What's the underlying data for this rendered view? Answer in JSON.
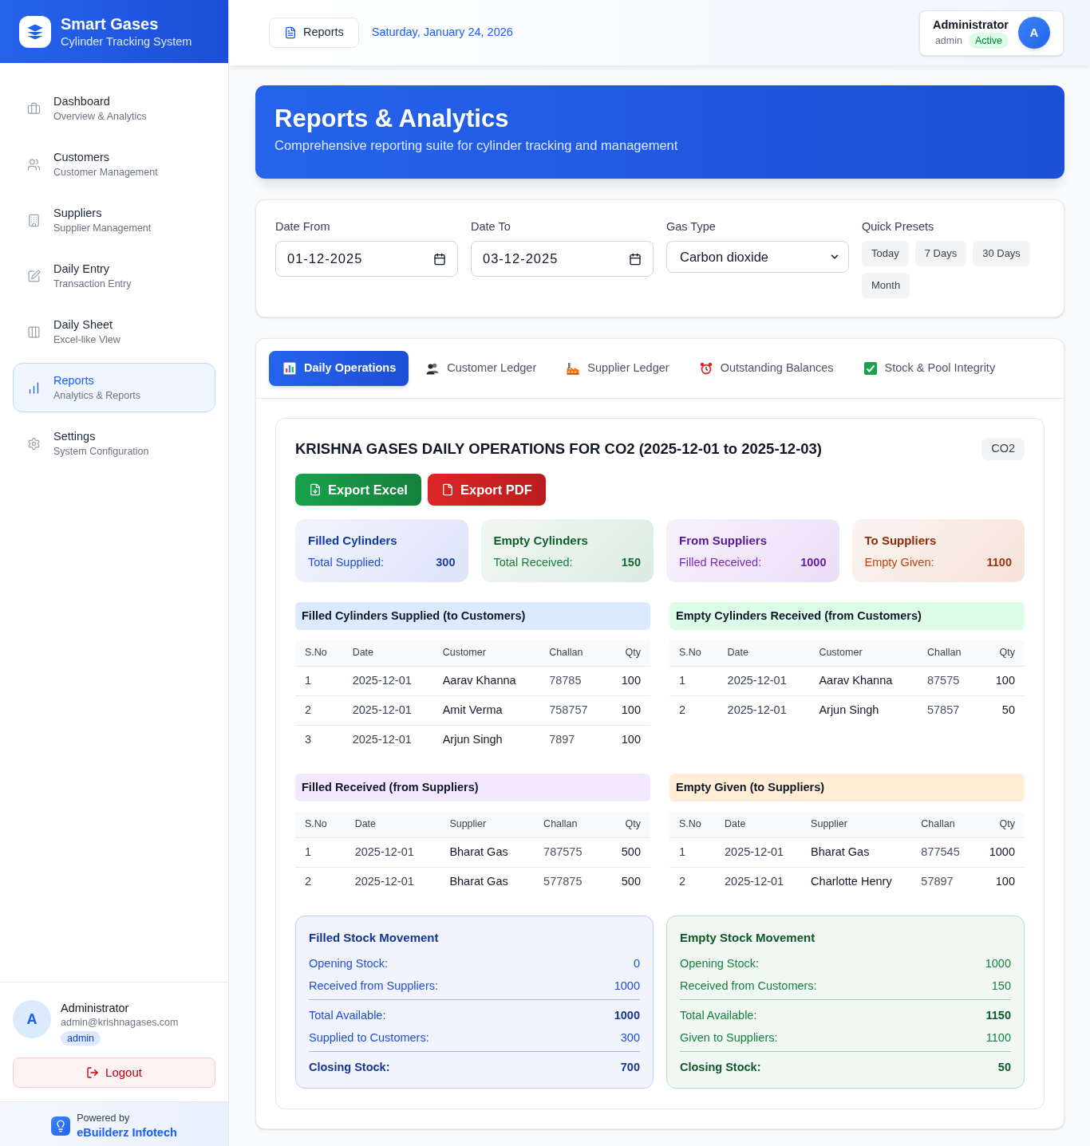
{
  "sidebar": {
    "brand": {
      "title": "Smart Gases",
      "subtitle": "Cylinder Tracking System"
    },
    "items": [
      {
        "label": "Dashboard",
        "sublabel": "Overview & Analytics",
        "selected": false
      },
      {
        "label": "Customers",
        "sublabel": "Customer Management",
        "selected": false
      },
      {
        "label": "Suppliers",
        "sublabel": "Supplier Management",
        "selected": false
      },
      {
        "label": "Daily Entry",
        "sublabel": "Transaction Entry",
        "selected": false
      },
      {
        "label": "Daily Sheet",
        "sublabel": "Excel-like View",
        "selected": false
      },
      {
        "label": "Reports",
        "sublabel": "Analytics & Reports",
        "selected": true
      },
      {
        "label": "Settings",
        "sublabel": "System Configuration",
        "selected": false
      }
    ],
    "user": {
      "avatar": "A",
      "name": "Administrator",
      "email": "admin@krishnagases.com",
      "role": "admin"
    },
    "logout": "Logout",
    "footer": {
      "caption": "Powered by",
      "company": "eBuilderz Infotech"
    }
  },
  "header": {
    "button": "Reports",
    "date": "Saturday, January 24, 2026",
    "user": {
      "name": "Administrator",
      "role": "admin",
      "status": "Active",
      "avatar": "A"
    }
  },
  "banner": {
    "title": "Reports & Analytics",
    "subtitle": "Comprehensive reporting suite for cylinder tracking and management"
  },
  "filters": {
    "date_from": {
      "label": "Date From",
      "value": "01-12-2025"
    },
    "date_to": {
      "label": "Date To",
      "value": "03-12-2025"
    },
    "gas_type": {
      "label": "Gas Type",
      "value": "Carbon dioxide"
    },
    "quick_presets": {
      "label": "Quick Presets",
      "buttons": [
        "Today",
        "7 Days",
        "30 Days",
        "Month"
      ]
    }
  },
  "tabs": [
    {
      "label": "Daily Operations",
      "selected": true
    },
    {
      "label": "Customer Ledger",
      "selected": false
    },
    {
      "label": "Supplier Ledger",
      "selected": false
    },
    {
      "label": "Outstanding Balances",
      "selected": false
    },
    {
      "label": "Stock & Pool Integrity",
      "selected": false
    }
  ],
  "report": {
    "title": "KRISHNA GASES DAILY OPERATIONS FOR CO2 (2025-12-01 to 2025-12-03)",
    "badge": "CO2",
    "exports": [
      {
        "kind": "excel",
        "label": "Export Excel"
      },
      {
        "kind": "pdf",
        "label": "Export PDF"
      }
    ],
    "summary": [
      {
        "title": "Filled Cylinders",
        "label": "Total Supplied:",
        "value": "300",
        "color": "#1d4ed8"
      },
      {
        "title": "Empty Cylinders",
        "label": "Total Received:",
        "value": "150",
        "color": "#15803d"
      },
      {
        "title": "From Suppliers",
        "label": "Filled Received:",
        "value": "1000",
        "color": "#7e22ce"
      },
      {
        "title": "To Suppliers",
        "label": "Empty Given:",
        "value": "1100",
        "color": "#c2410c"
      }
    ],
    "tables": [
      {
        "title": "Filled Cylinders Supplied (to Customers)",
        "color": "#dbeafe",
        "columns": [
          "S.No",
          "Date",
          "Customer",
          "Challan",
          "Qty"
        ],
        "rows": [
          [
            "1",
            "2025-12-01",
            "Aarav Khanna",
            "78785",
            "100"
          ],
          [
            "2",
            "2025-12-01",
            "Amit Verma",
            "758757",
            "100"
          ],
          [
            "3",
            "2025-12-01",
            "Arjun Singh",
            "7897",
            "100"
          ]
        ]
      },
      {
        "title": "Empty Cylinders Received (from Customers)",
        "color": "#dcfce7",
        "columns": [
          "S.No",
          "Date",
          "Customer",
          "Challan",
          "Qty"
        ],
        "rows": [
          [
            "1",
            "2025-12-01",
            "Aarav Khanna",
            "87575",
            "100"
          ],
          [
            "2",
            "2025-12-01",
            "Arjun Singh",
            "57857",
            "50"
          ]
        ]
      },
      {
        "title": "Filled Received (from Suppliers)",
        "color": "#f3e8ff",
        "columns": [
          "S.No",
          "Date",
          "Supplier",
          "Challan",
          "Qty"
        ],
        "rows": [
          [
            "1",
            "2025-12-01",
            "Bharat Gas",
            "787575",
            "500"
          ],
          [
            "2",
            "2025-12-01",
            "Bharat Gas",
            "577875",
            "500"
          ]
        ]
      },
      {
        "title": "Empty Given (to Suppliers)",
        "color": "#ffedd5",
        "columns": [
          "S.No",
          "Date",
          "Supplier",
          "Challan",
          "Qty"
        ],
        "rows": [
          [
            "1",
            "2025-12-01",
            "Bharat Gas",
            "877545",
            "1000"
          ],
          [
            "2",
            "2025-12-01",
            "Charlotte Henry",
            "57897",
            "100"
          ]
        ]
      }
    ],
    "stock": [
      {
        "title": "Filled Stock Movement",
        "color": "#1d4ed8",
        "rows": [
          {
            "kind": "item",
            "label": "Opening Stock:",
            "value": "0"
          },
          {
            "kind": "item",
            "label": "Received from Suppliers:",
            "value": "1000"
          },
          {
            "kind": "subtotal",
            "label": "Total Available:",
            "value": "1000"
          },
          {
            "kind": "item",
            "label": "Supplied to Customers:",
            "value": "300"
          },
          {
            "kind": "closing",
            "label": "Closing Stock:",
            "value": "700"
          }
        ]
      },
      {
        "title": "Empty Stock Movement",
        "color": "#15803d",
        "rows": [
          {
            "kind": "item",
            "label": "Opening Stock:",
            "value": "1000"
          },
          {
            "kind": "item",
            "label": "Received from Customers:",
            "value": "150"
          },
          {
            "kind": "subtotal",
            "label": "Total Available:",
            "value": "1150"
          },
          {
            "kind": "item",
            "label": "Given to Suppliers:",
            "value": "1100"
          },
          {
            "kind": "closing",
            "label": "Closing Stock:",
            "value": "50"
          }
        ]
      }
    ]
  }
}
